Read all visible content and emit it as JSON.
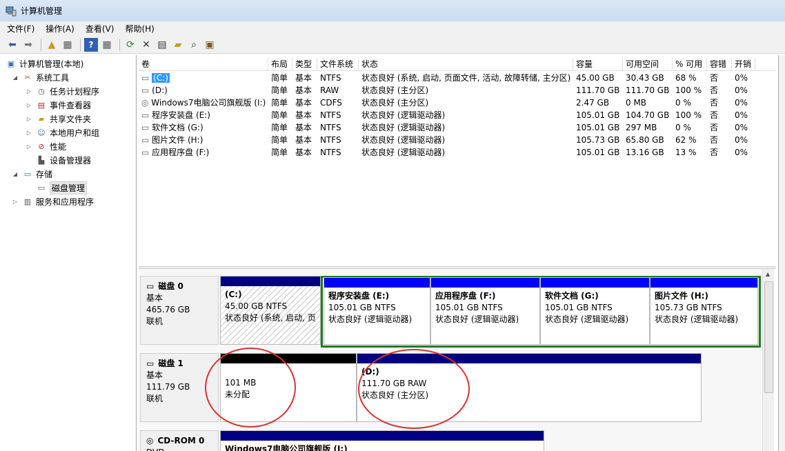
{
  "window": {
    "title": "计算机管理"
  },
  "menu": [
    "文件(F)",
    "操作(A)",
    "查看(V)",
    "帮助(H)"
  ],
  "tree": {
    "root": "计算机管理(本地)",
    "system_tools": "系统工具",
    "task_scheduler": "任务计划程序",
    "event_viewer": "事件查看器",
    "shared_folders": "共享文件夹",
    "local_users": "本地用户和组",
    "performance": "性能",
    "device_manager": "设备管理器",
    "storage": "存储",
    "disk_management": "磁盘管理",
    "services_apps": "服务和应用程序"
  },
  "volume_table": {
    "columns": [
      "卷",
      "布局",
      "类型",
      "文件系统",
      "状态",
      "容量",
      "可用空间",
      "% 可用",
      "容错",
      "开销"
    ],
    "rows": [
      [
        "(C:)",
        "简单",
        "基本",
        "NTFS",
        "状态良好 (系统, 启动, 页面文件, 活动, 故障转储, 主分区)",
        "45.00 GB",
        "30.43 GB",
        "68 %",
        "否",
        "0%"
      ],
      [
        "(D:)",
        "简单",
        "基本",
        "RAW",
        "状态良好 (主分区)",
        "111.70 GB",
        "111.70 GB",
        "100 %",
        "否",
        "0%"
      ],
      [
        "Windows7电脑公司旗舰版 (I:)",
        "简单",
        "基本",
        "CDFS",
        "状态良好 (主分区)",
        "2.47 GB",
        "0 MB",
        "0 %",
        "否",
        "0%"
      ],
      [
        "程序安装盘 (E:)",
        "简单",
        "基本",
        "NTFS",
        "状态良好 (逻辑驱动器)",
        "105.01 GB",
        "104.70 GB",
        "100 %",
        "否",
        "0%"
      ],
      [
        "软件文档 (G:)",
        "简单",
        "基本",
        "NTFS",
        "状态良好 (逻辑驱动器)",
        "105.01 GB",
        "297 MB",
        "0 %",
        "否",
        "0%"
      ],
      [
        "图片文件 (H:)",
        "简单",
        "基本",
        "NTFS",
        "状态良好 (逻辑驱动器)",
        "105.73 GB",
        "65.80 GB",
        "62 %",
        "否",
        "0%"
      ],
      [
        "应用程序盘 (F:)",
        "简单",
        "基本",
        "NTFS",
        "状态良好 (逻辑驱动器)",
        "105.01 GB",
        "13.16 GB",
        "13 %",
        "否",
        "0%"
      ]
    ]
  },
  "disks": {
    "disk0": {
      "name": "磁盘 0",
      "type": "基本",
      "size": "465.76 GB",
      "status": "联机",
      "partitions": [
        {
          "name": "(C:)",
          "size": "45.00 GB NTFS",
          "status": "状态良好 (系统, 启动, 页"
        },
        {
          "name": "程序安装盘  (E:)",
          "size": "105.01 GB NTFS",
          "status": "状态良好 (逻辑驱动器)"
        },
        {
          "name": "应用程序盘  (F:)",
          "size": "105.01 GB NTFS",
          "status": "状态良好 (逻辑驱动器)"
        },
        {
          "name": "软件文档  (G:)",
          "size": "105.01 GB NTFS",
          "status": "状态良好 (逻辑驱动器)"
        },
        {
          "name": "图片文件  (H:)",
          "size": "105.73 GB NTFS",
          "status": "状态良好 (逻辑驱动器)"
        }
      ]
    },
    "disk1": {
      "name": "磁盘 1",
      "type": "基本",
      "size": "111.79 GB",
      "status": "联机",
      "partitions": [
        {
          "size": "101 MB",
          "status": "未分配"
        },
        {
          "name": "(D:)",
          "size": "111.70 GB RAW",
          "status": "状态良好 (主分区)"
        }
      ]
    },
    "cdrom0": {
      "name": "CD-ROM 0",
      "type": "DVD",
      "partition_name": "Windows7电脑公司旗舰版  (I:)"
    }
  },
  "colors": {
    "primary_bar": "#000080",
    "logical_bar": "#0000ff",
    "unallocated_bar": "#000000",
    "extended_frame": "#1e7e1e",
    "annotation": "#d9332f"
  }
}
